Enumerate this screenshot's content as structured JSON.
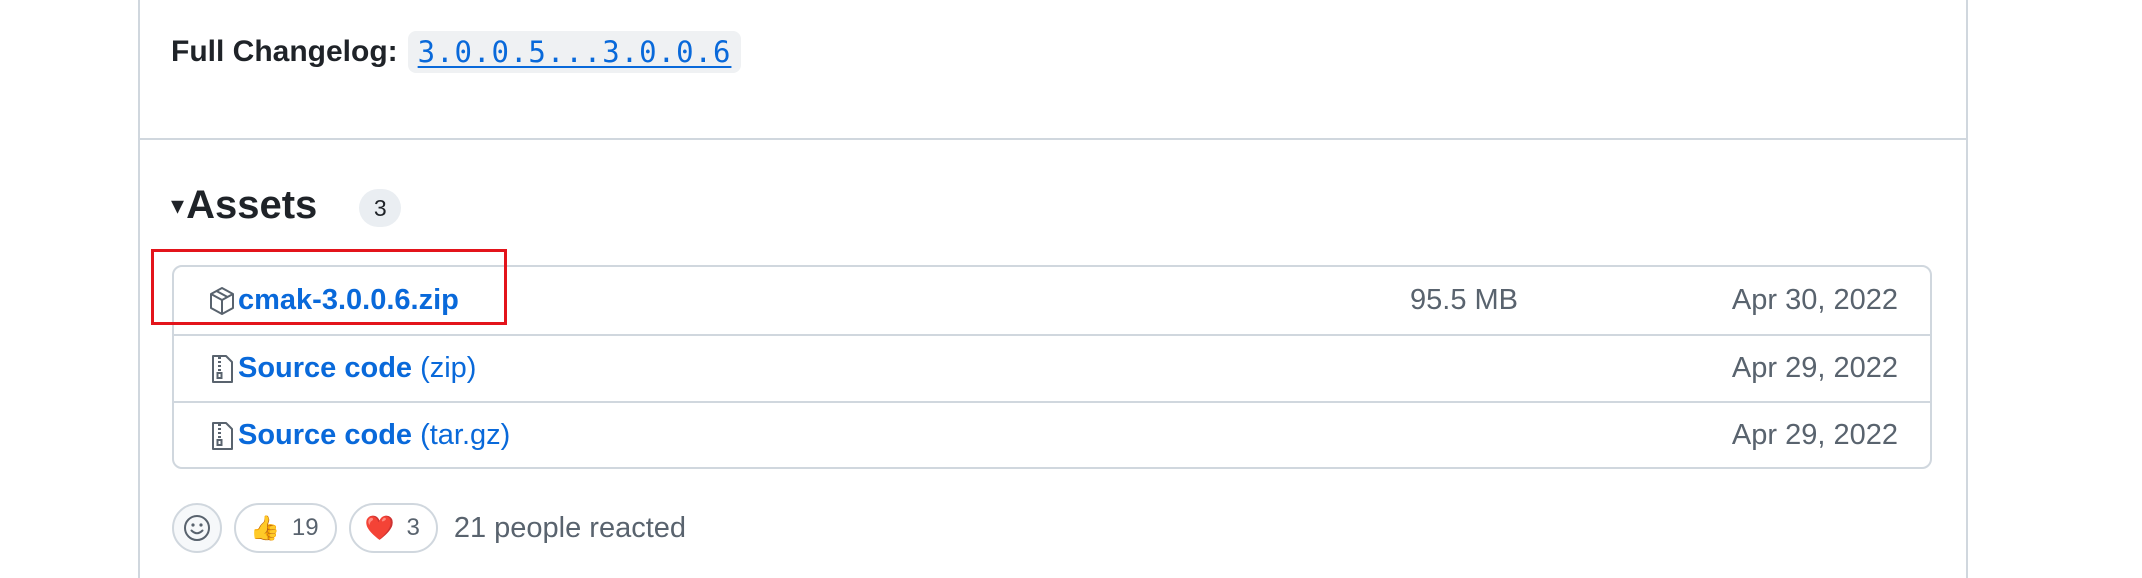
{
  "changelog": {
    "label": "Full Changelog:",
    "link": "3.0.0.5...3.0.0.6"
  },
  "assets": {
    "caret": "▾",
    "title": "Assets",
    "count": "3",
    "items": [
      {
        "icon": "package-icon",
        "name": "cmak-3.0.0.6.zip",
        "suffix": "",
        "size": "95.5 MB",
        "date": "Apr 30, 2022",
        "highlighted": true
      },
      {
        "icon": "file-zip-icon",
        "name": "Source code",
        "suffix": "(zip)",
        "size": "",
        "date": "Apr 29, 2022"
      },
      {
        "icon": "file-zip-icon",
        "name": "Source code",
        "suffix": "(tar.gz)",
        "size": "",
        "date": "Apr 29, 2022"
      }
    ]
  },
  "reactions": {
    "items": [
      {
        "emoji": "👍",
        "count": "19"
      },
      {
        "emoji": "❤️",
        "count": "3"
      }
    ],
    "summary": "21 people reacted"
  },
  "colors": {
    "link": "#0969da",
    "highlight": "#e3141b",
    "border": "#d0d7de",
    "muted": "#59636e"
  }
}
